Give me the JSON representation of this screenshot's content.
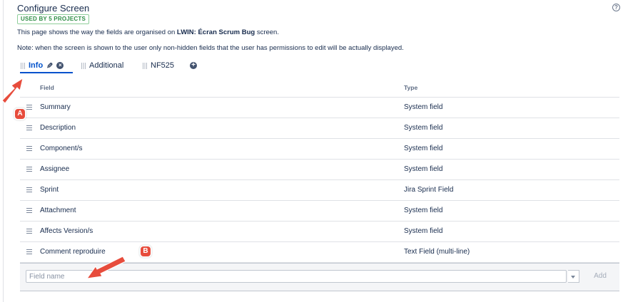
{
  "header": {
    "title": "Configure Screen",
    "usage_lozenge": "USED BY 5 PROJECTS",
    "help_icon": "question-circle-icon",
    "help_glyph": "?"
  },
  "description": {
    "prefix": "This page shows the way the fields are organised on ",
    "screen_name": "LWIN: Écran Scrum Bug",
    "suffix": " screen."
  },
  "note": "Note: when the screen is shown to the user only non-hidden fields that the user has permissions to edit will be actually displayed.",
  "tabs": [
    {
      "label": "Info",
      "active": true
    },
    {
      "label": "Additional",
      "active": false
    },
    {
      "label": "NF525",
      "active": false
    }
  ],
  "tab_icons": {
    "edit": "pencil-icon",
    "remove": "close-circle-icon",
    "add": "plus-circle-icon",
    "remove_glyph": "×",
    "add_glyph": "+"
  },
  "table": {
    "columns": {
      "field": "Field",
      "type": "Type"
    },
    "rows": [
      {
        "field": "Summary",
        "type": "System field"
      },
      {
        "field": "Description",
        "type": "System field"
      },
      {
        "field": "Component/s",
        "type": "System field"
      },
      {
        "field": "Assignee",
        "type": "System field"
      },
      {
        "field": "Sprint",
        "type": "Jira Sprint Field"
      },
      {
        "field": "Attachment",
        "type": "System field"
      },
      {
        "field": "Affects Version/s",
        "type": "System field"
      },
      {
        "field": "Comment reproduire",
        "type": "Text Field (multi-line)"
      }
    ]
  },
  "add_field": {
    "placeholder": "Field name",
    "value": "",
    "add_label": "Add"
  },
  "annotations": {
    "marker_a": "A",
    "marker_b": "B",
    "color": "#e74c3c"
  },
  "colors": {
    "accent": "#0052cc",
    "lozenge": "#2f8e46"
  }
}
